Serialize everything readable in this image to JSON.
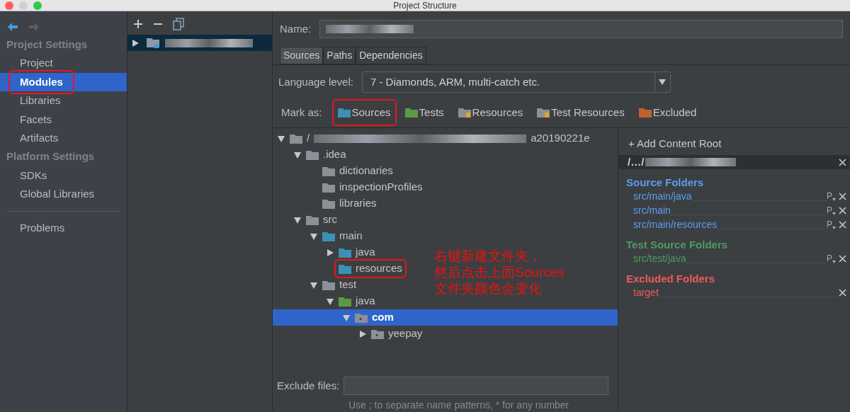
{
  "window": {
    "title": "Project Structure"
  },
  "sidebar": {
    "groups": [
      {
        "title": "Project Settings",
        "items": [
          {
            "label": "Project",
            "selected": false,
            "highlighted": false
          },
          {
            "label": "Modules",
            "selected": true,
            "highlighted": true
          },
          {
            "label": "Libraries",
            "selected": false,
            "highlighted": false
          },
          {
            "label": "Facets",
            "selected": false,
            "highlighted": false
          },
          {
            "label": "Artifacts",
            "selected": false,
            "highlighted": false
          }
        ]
      },
      {
        "title": "Platform Settings",
        "items": [
          {
            "label": "SDKs",
            "selected": false,
            "highlighted": false
          },
          {
            "label": "Global Libraries",
            "selected": false,
            "highlighted": false
          }
        ]
      }
    ],
    "footer_items": [
      {
        "label": "Problems",
        "selected": false,
        "highlighted": false
      }
    ]
  },
  "module_tree": {
    "items": [
      {
        "selected": true,
        "expanded": false
      }
    ]
  },
  "name_label": "Name:",
  "tabs": [
    {
      "label": "Sources",
      "selected": true
    },
    {
      "label": "Paths",
      "selected": false
    },
    {
      "label": "Dependencies",
      "selected": false
    }
  ],
  "language_level": {
    "label": "Language level:",
    "value": "7 - Diamonds, ARM, multi-catch etc."
  },
  "mark_as": {
    "label": "Mark as:",
    "buttons": [
      {
        "label": "Sources",
        "kind": "sources",
        "highlighted": true
      },
      {
        "label": "Tests",
        "kind": "tests",
        "highlighted": false
      },
      {
        "label": "Resources",
        "kind": "resources",
        "highlighted": false
      },
      {
        "label": "Test Resources",
        "kind": "test_resources",
        "highlighted": false
      },
      {
        "label": "Excluded",
        "kind": "excluded",
        "highlighted": false
      }
    ]
  },
  "tree": [
    {
      "prefix": "/",
      "suffix": "a20190221e",
      "kind": "plain",
      "expanded": true,
      "selected": false,
      "highlighted": false,
      "children": [
        {
          "label": ".idea",
          "kind": "plain",
          "expanded": true,
          "selected": false,
          "highlighted": false,
          "children": [
            {
              "label": "dictionaries",
              "kind": "plain",
              "selected": false,
              "highlighted": false
            },
            {
              "label": "inspectionProfiles",
              "kind": "plain",
              "selected": false,
              "highlighted": false
            },
            {
              "label": "libraries",
              "kind": "plain",
              "selected": false,
              "highlighted": false
            }
          ]
        },
        {
          "label": "src",
          "kind": "plain",
          "expanded": true,
          "selected": false,
          "highlighted": false,
          "children": [
            {
              "label": "main",
              "kind": "sources",
              "expanded": true,
              "selected": false,
              "highlighted": false,
              "children": [
                {
                  "label": "java",
                  "kind": "sources",
                  "expanded": false,
                  "selected": false,
                  "highlighted": false
                },
                {
                  "label": "resources",
                  "kind": "sources",
                  "selected": false,
                  "highlighted": true
                }
              ]
            },
            {
              "label": "test",
              "kind": "plain",
              "expanded": true,
              "selected": false,
              "highlighted": false,
              "children": [
                {
                  "label": "java",
                  "kind": "tests",
                  "expanded": true,
                  "selected": false,
                  "highlighted": false,
                  "children": [
                    {
                      "label": "com",
                      "kind": "package",
                      "expanded": true,
                      "selected": true,
                      "highlighted": false,
                      "children": [
                        {
                          "label": "yeepay",
                          "kind": "package",
                          "expanded": false,
                          "selected": false,
                          "highlighted": false
                        }
                      ]
                    }
                  ]
                }
              ]
            }
          ]
        }
      ]
    }
  ],
  "annotation": [
    "右键新建文件夹，",
    "然后点击上面Sources",
    "文件夹颜色会变化"
  ],
  "exclude_files": {
    "label": "Exclude files:",
    "hint": "Use ; to separate name patterns, * for any number"
  },
  "content_roots": {
    "add_label": "+ Add Content Root",
    "root_prefix": "/…/",
    "sections": [
      {
        "title": "Source Folders",
        "color": "#5c9cf0",
        "items": [
          {
            "path": "src/main/java",
            "prefix_button": "P"
          },
          {
            "path": "src/main",
            "prefix_button": "P"
          },
          {
            "path": "src/main/resources",
            "prefix_button": "P"
          }
        ]
      },
      {
        "title": "Test Source Folders",
        "color": "#4f9a62",
        "items": [
          {
            "path": "src/test/java",
            "prefix_button": "P"
          }
        ]
      },
      {
        "title": "Excluded Folders",
        "color": "#ef5a5a",
        "items": [
          {
            "path": "target"
          }
        ]
      }
    ]
  }
}
